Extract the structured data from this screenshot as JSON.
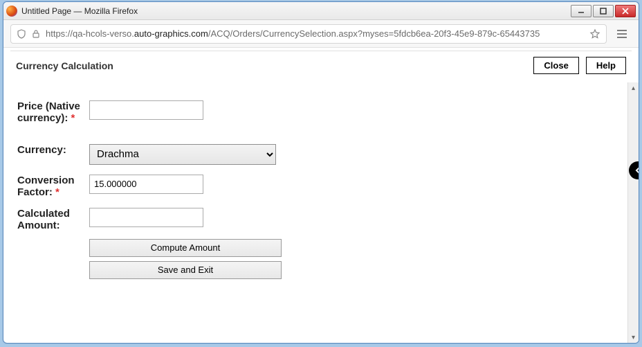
{
  "window": {
    "title": "Untitled Page — Mozilla Firefox"
  },
  "url": {
    "prefix": "https://qa-hcols-verso.",
    "bold": "auto-graphics.com",
    "suffix": "/ACQ/Orders/CurrencySelection.aspx?myses=5fdcb6ea-20f3-45e9-879c-65443735"
  },
  "header": {
    "title": "Currency Calculation",
    "close_label": "Close",
    "help_label": "Help"
  },
  "form": {
    "price_label": "Price (Native currency):",
    "price_value": "",
    "currency_label": "Currency:",
    "currency_selected": "Drachma",
    "conversion_label": "Conversion Factor:",
    "conversion_value": "15.000000",
    "calculated_label": "Calculated Amount:",
    "calculated_value": "",
    "compute_label": "Compute Amount",
    "save_label": "Save and Exit",
    "required_mark": "*"
  }
}
